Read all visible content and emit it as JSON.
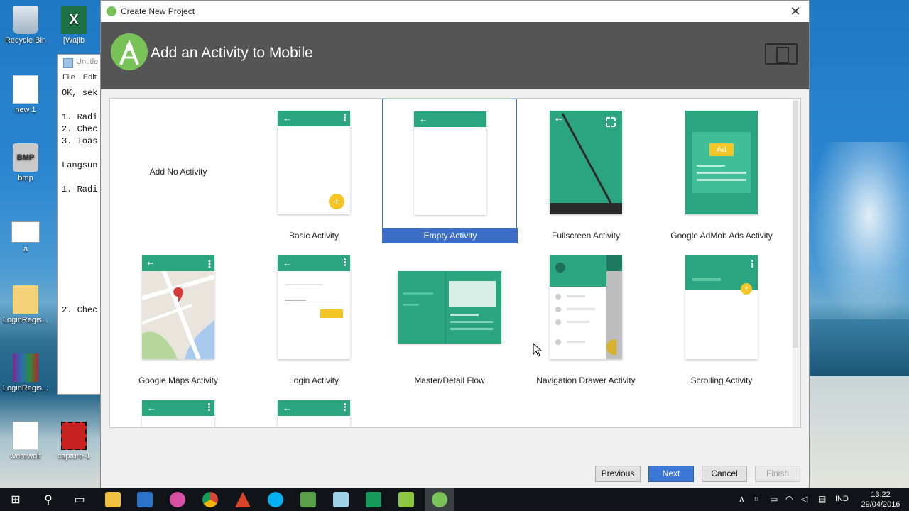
{
  "desktop": {
    "icons": [
      {
        "label": "Recycle Bin"
      },
      {
        "label": "[Wajib"
      },
      {
        "label": "new 1"
      },
      {
        "label": "bmp",
        "badge": "BMP"
      },
      {
        "label": "a"
      },
      {
        "label": "LoginRegis..."
      },
      {
        "label": "LoginRegis..."
      },
      {
        "label": "werewolf"
      },
      {
        "label": "capture-1"
      }
    ]
  },
  "notepad": {
    "title": "Untitle",
    "menu": [
      "File",
      "Edit"
    ],
    "lines": "OK, sek\n\n1. Radi\n2. Chec\n3. Toas\n\nLangsun\n\n1. Radi\n\n\n\n\n\n\n\n\n\n2. Chec"
  },
  "dialog": {
    "title": "Create New Project",
    "heading": "Add an Activity to Mobile",
    "templates": [
      {
        "label": "Add No Activity"
      },
      {
        "label": "Basic Activity"
      },
      {
        "label": "Empty Activity",
        "selected": true
      },
      {
        "label": "Fullscreen Activity"
      },
      {
        "label": "Google AdMob Ads Activity",
        "ad_badge": "Ad"
      },
      {
        "label": "Google Maps Activity"
      },
      {
        "label": "Login Activity"
      },
      {
        "label": "Master/Detail Flow"
      },
      {
        "label": "Navigation Drawer Activity"
      },
      {
        "label": "Scrolling Activity"
      }
    ],
    "buttons": {
      "previous": "Previous",
      "next": "Next",
      "cancel": "Cancel",
      "finish": "Finish"
    },
    "close": "✕"
  },
  "taskbar": {
    "lang": "IND",
    "time": "13:22",
    "date": "29/04/2016"
  },
  "colors": {
    "accent": "#2aa580",
    "selection": "#3c6ec8",
    "header": "#555555",
    "fab": "#f3c625"
  }
}
